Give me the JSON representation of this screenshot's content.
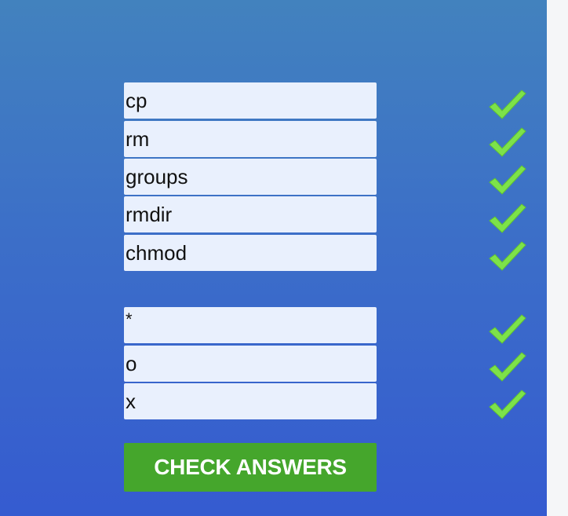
{
  "form": {
    "group1": [
      {
        "value": "cp",
        "status": "correct"
      },
      {
        "value": "rm",
        "status": "correct"
      },
      {
        "value": "groups",
        "status": "correct"
      },
      {
        "value": "rmdir",
        "status": "correct"
      },
      {
        "value": "chmod",
        "status": "correct"
      }
    ],
    "group2": [
      {
        "value": "*",
        "status": "correct"
      },
      {
        "value": "o",
        "status": "correct"
      },
      {
        "value": "x",
        "status": "correct"
      }
    ],
    "check_button_label": "CHECK ANSWERS"
  },
  "icons": {
    "correct": "checkmark-icon"
  },
  "colors": {
    "panel_top": "#4282be",
    "panel_bottom": "#355bd0",
    "input_bg": "#e9f0fd",
    "check_green": "#7de24a",
    "button_green": "#45a62c"
  }
}
